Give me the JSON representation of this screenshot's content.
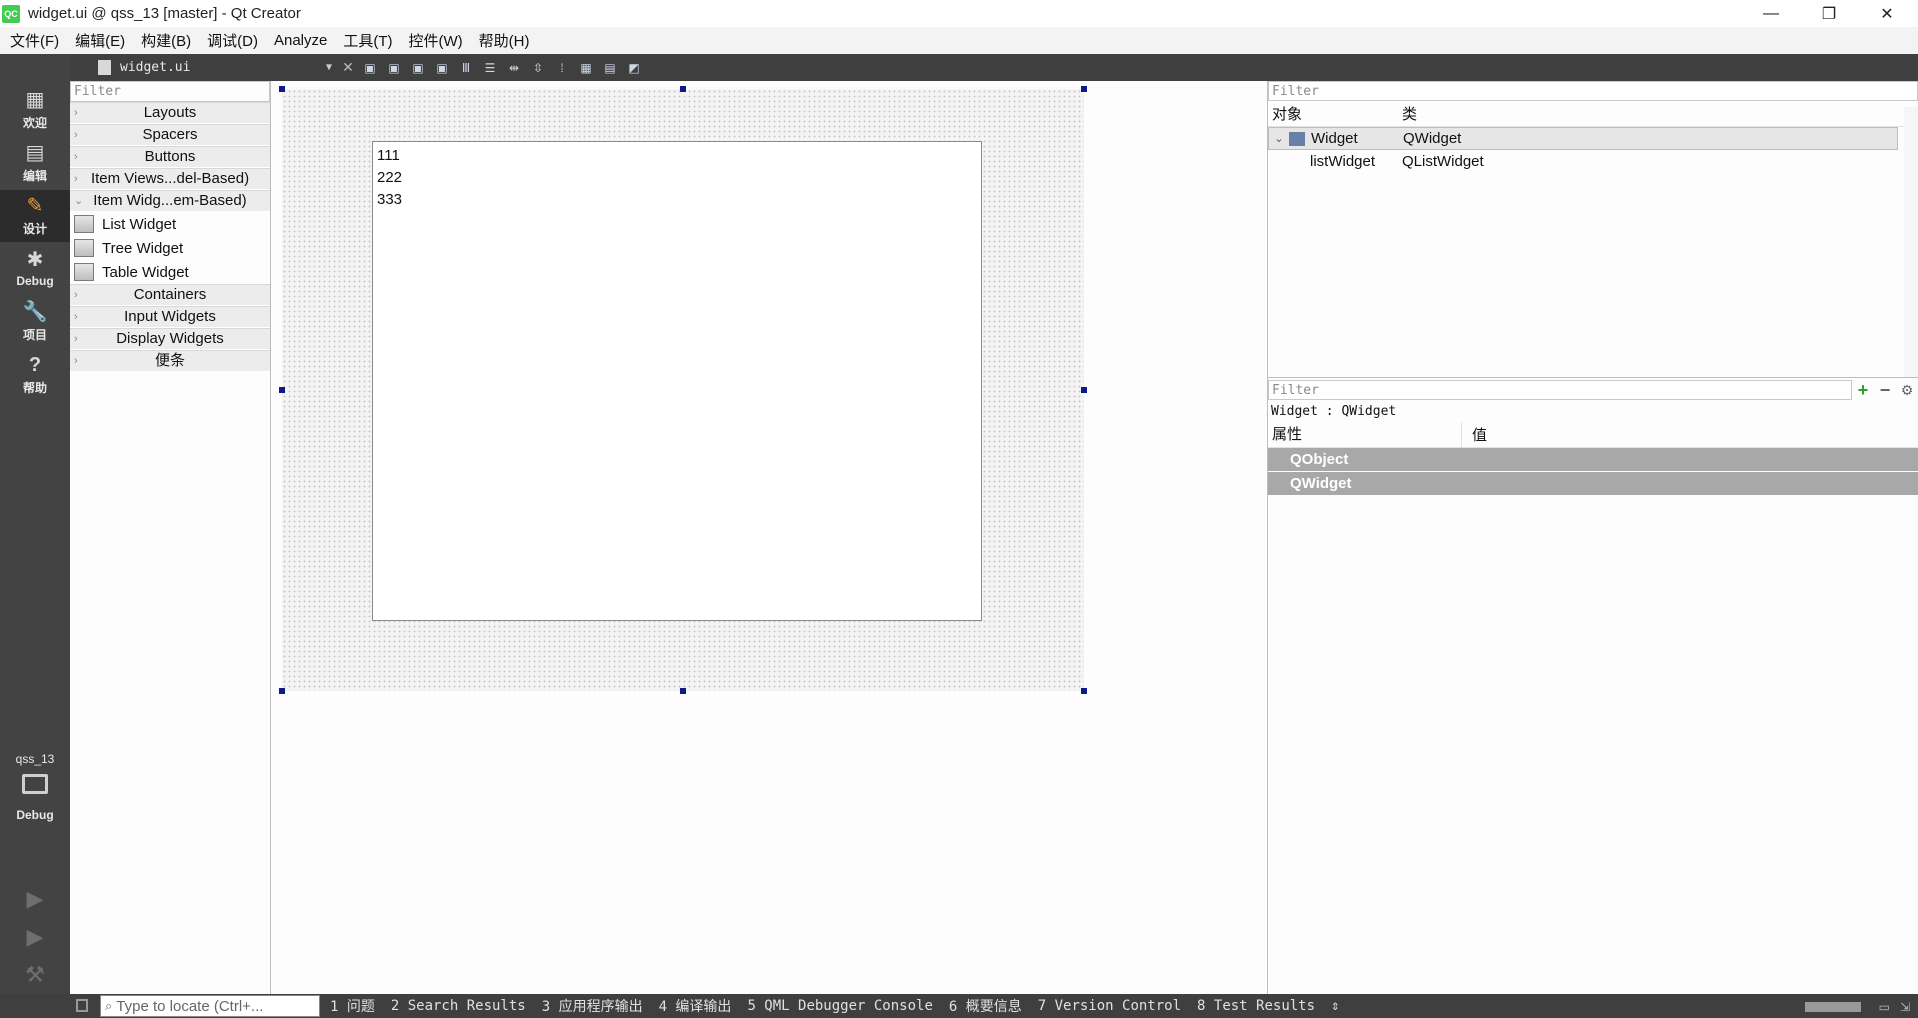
{
  "window": {
    "app_icon": "QC",
    "title": "widget.ui @ qss_13 [master] - Qt Creator",
    "controls": [
      "—",
      "❐",
      "✕"
    ]
  },
  "menubar": [
    "文件(F)",
    "编辑(E)",
    "构建(B)",
    "调试(D)",
    "Analyze",
    "工具(T)",
    "控件(W)",
    "帮助(H)"
  ],
  "modes": [
    {
      "label": "欢迎",
      "icon": "grid-icon",
      "glyph": "▦"
    },
    {
      "label": "编辑",
      "icon": "edit-doc-icon",
      "glyph": "▤"
    },
    {
      "label": "设计",
      "icon": "pencil-icon",
      "glyph": "✎"
    },
    {
      "label": "Debug",
      "icon": "bug-icon",
      "glyph": "✱"
    },
    {
      "label": "项目",
      "icon": "wrench-icon",
      "glyph": "🔧"
    },
    {
      "label": "帮助",
      "icon": "help-icon",
      "glyph": "?"
    }
  ],
  "kit": {
    "project": "qss_13",
    "build": "Debug"
  },
  "editor": {
    "file_name": "widget.ui"
  },
  "widget_box": {
    "filter_placeholder": "Filter",
    "categories_top": [
      "Layouts",
      "Spacers",
      "Buttons",
      "Item Views...del-Based)"
    ],
    "expanded_category": "Item Widg...em-Based)",
    "items": [
      "List Widget",
      "Tree Widget",
      "Table Widget"
    ],
    "categories_bottom": [
      "Containers",
      "Input Widgets",
      "Display Widgets",
      "便条"
    ]
  },
  "form": {
    "list_items": [
      "111",
      "222",
      "333"
    ]
  },
  "object_inspector": {
    "filter_placeholder": "Filter",
    "columns": [
      "对象",
      "类"
    ],
    "rows": [
      {
        "object": "Widget",
        "class": "QWidget"
      },
      {
        "object": "listWidget",
        "class": "QListWidget"
      }
    ]
  },
  "property_editor": {
    "filter_placeholder": "Filter",
    "object_label": "Widget : QWidget",
    "columns": [
      "属性",
      "值"
    ],
    "groups": [
      "QObject",
      "QWidget"
    ],
    "add_glyph": "+",
    "remove_glyph": "−",
    "config_glyph": "⚙"
  },
  "statusbar": {
    "locator_placeholder": "Type to locate (Ctrl+...",
    "tabs": [
      "1 问题",
      "2 Search Results",
      "3 应用程序输出",
      "4 编译输出",
      "5 QML Debugger Console",
      "6 概要信息",
      "7 Version Control",
      "8 Test Results"
    ],
    "more_glyph": "⇕"
  },
  "colors": {
    "modebar": "#434343",
    "active_mode_icon": "#f29b38",
    "handle": "#0c1b8a",
    "add_button": "#2e9e2e",
    "group_row": "#a8a8a8"
  }
}
